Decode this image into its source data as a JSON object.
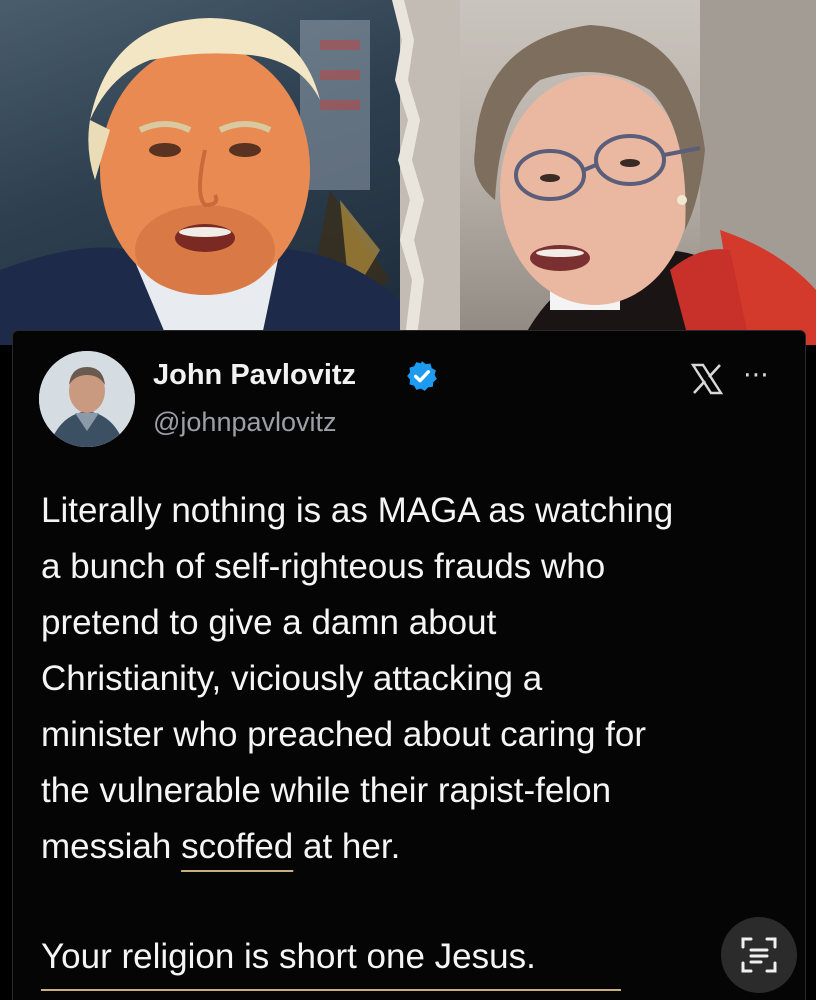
{
  "tweet": {
    "display_name": "John Pavlovitz",
    "handle": "@johnpavlovitz",
    "body_lines": [
      "Literally nothing is as MAGA as watching",
      "a bunch of self-righteous frauds who",
      "pretend to give a damn about",
      "Christianity, viciously attacking a",
      "minister who preached about caring for",
      "the vulnerable while their rapist-felon"
    ],
    "last_line_prefix": "messiah ",
    "last_line_underlined": "scoffed",
    "last_line_suffix": " at her.",
    "closing": "Your religion is short one Jesus.",
    "verified": true
  },
  "icons": {
    "verified": "verified-badge-icon",
    "platform": "x-logo-icon",
    "more": "more-options-icon",
    "scan": "text-scan-icon"
  },
  "colors": {
    "card_background": "#050505",
    "text": "#f5f5f5",
    "handle": "#9aa0a6",
    "verified_blue": "#1d9bf0",
    "underline": "#c9b07a"
  }
}
